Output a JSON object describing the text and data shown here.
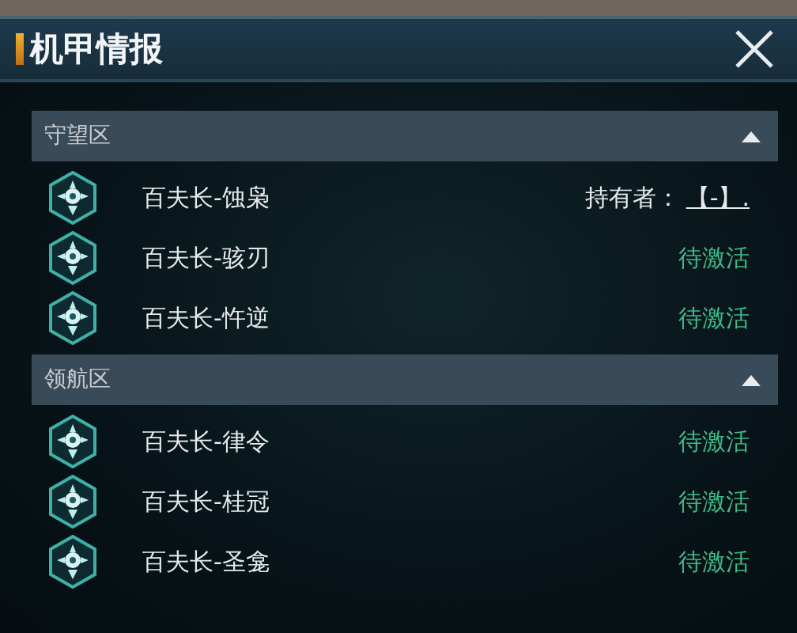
{
  "window": {
    "title": "机甲情报"
  },
  "sections": [
    {
      "title": "守望区",
      "expanded": true,
      "items": [
        {
          "name": "百夫长-蚀枭",
          "kind": "owner",
          "owner_label": "持有者：",
          "owner_value": "【-】."
        },
        {
          "name": "百夫长-骇刃",
          "kind": "status",
          "status": "待激活"
        },
        {
          "name": "百夫长-忤逆",
          "kind": "status",
          "status": "待激活"
        }
      ]
    },
    {
      "title": "领航区",
      "expanded": true,
      "items": [
        {
          "name": "百夫长-律令",
          "kind": "status",
          "status": "待激活"
        },
        {
          "name": "百夫长-桂冠",
          "kind": "status",
          "status": "待激活"
        },
        {
          "name": "百夫长-圣龛",
          "kind": "status",
          "status": "待激活"
        }
      ]
    }
  ]
}
